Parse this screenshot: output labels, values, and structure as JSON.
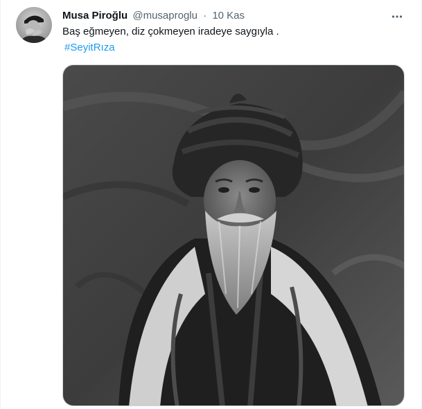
{
  "tweet": {
    "author_name": "Musa Piroğlu",
    "author_handle": "@musaproglu",
    "separator": "·",
    "time": "10 Kas",
    "text": "Baş eğmeyen, diz çokmeyen iradeye saygıyla .",
    "hashtag": "#SeyitRıza"
  },
  "icons": {
    "more": "more-horizontal-icon",
    "avatar": "avatar"
  },
  "colors": {
    "text": "#0f1419",
    "secondary": "#536471",
    "link": "#1d9bf0",
    "border": "#cfd9de"
  }
}
